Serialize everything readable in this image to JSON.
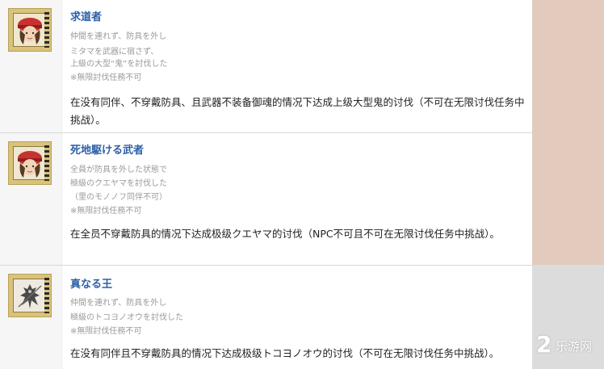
{
  "entries": [
    {
      "title": "求道者",
      "conditions": [
        "仲間を連れず、防具を外し",
        "ミタマを武器に宿さず、",
        "上級の大型“鬼”を討伐した",
        "※無限討伐任務不可"
      ],
      "description": "在没有同伴、不穿戴防具、且武器不装备御魂的情况下达成上级大型鬼的讨伐（不可在无限讨伐任务中挑战）。",
      "icon": "masked-warrior-red-hat-portrait-icon"
    },
    {
      "title": "死地駆ける武者",
      "conditions": [
        "全員が防具を外した状態で",
        "極級のクエヤマを討伐した",
        "（里のモノノフ同伴不可）",
        "※無限討伐任務不可"
      ],
      "description": "在全员不穿戴防具的情况下达成极级クエヤマ的讨伐（NPC不可且不可在无限讨伐任务中挑战）。",
      "icon": "masked-warrior-red-hat-portrait-icon"
    },
    {
      "title": "真なる王",
      "conditions": [
        "仲間を連れず、防具を外し",
        "極級のトコヨノオウを討伐した",
        "※無限討伐任務不可"
      ],
      "description": "在没有同伴且不穿戴防具的情况下达成极级トコヨノオウ的讨伐（不可在无限讨伐任务中挑战）。",
      "icon": "demon-king-silhouette-portrait-icon"
    }
  ],
  "watermark": {
    "text": "乐游网",
    "mark": "2"
  },
  "colors": {
    "title": "#2a5fa8",
    "condition": "#9a9a9a",
    "description": "#222222",
    "band_rose": "#e2cbbd",
    "band_gray": "#dcdcdc"
  }
}
